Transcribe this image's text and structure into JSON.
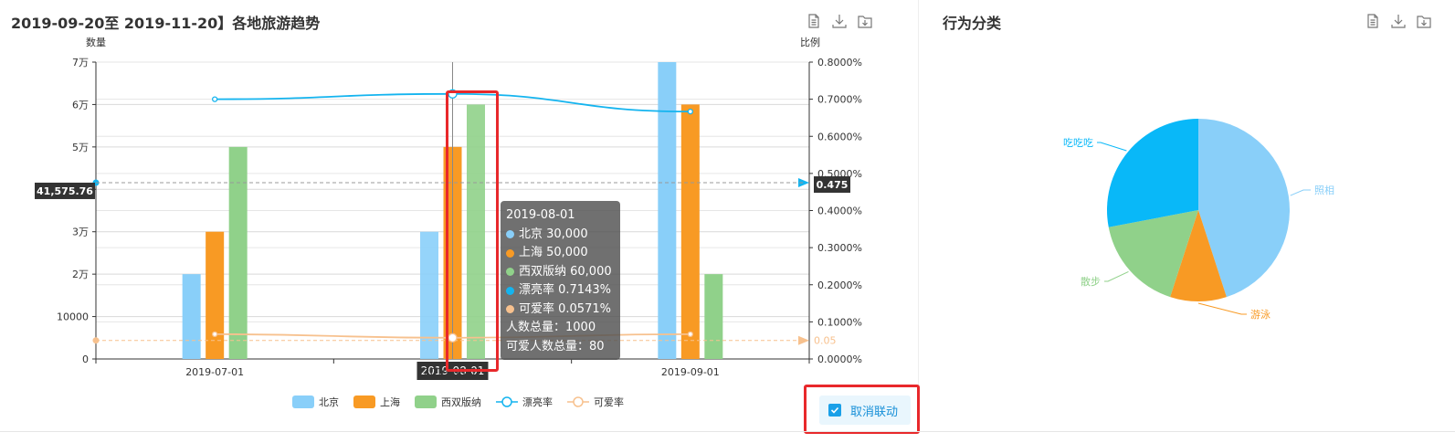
{
  "left_panel": {
    "title": "2019-09-20至 2019-11-20】各地旅游趋势",
    "toolbox": [
      "data-view-icon",
      "download-icon",
      "save-folder-icon"
    ]
  },
  "right_panel": {
    "title": "行为分类",
    "toolbox": [
      "data-view-icon",
      "download-icon",
      "save-folder-icon"
    ]
  },
  "unlink_button": {
    "label": "取消联动",
    "checked": true
  },
  "tooltip": {
    "title": "2019-08-01",
    "rows": [
      {
        "label": "北京  30,000",
        "color": "#89cff9"
      },
      {
        "label": "上海  50,000",
        "color": "#f89a24"
      },
      {
        "label": "西双版纳  60,000",
        "color": "#90d18a"
      },
      {
        "label": "漂亮率  0.7143%",
        "color": "#14b4ef"
      },
      {
        "label": "可爱率  0.0571%",
        "color": "#f7c18e"
      }
    ],
    "extra": [
      "人数总量：1000",
      "可爱人数总量：80"
    ]
  },
  "chart_data": [
    {
      "type": "bar",
      "title": "2019-09-20至 2019-11-20】各地旅游趋势",
      "categories": [
        "2019-07-01",
        "2019-08-01",
        "2019-09-01"
      ],
      "ylabel_left": "数量",
      "ylabel_right": "比例",
      "ylim_left": [
        0,
        70000
      ],
      "yticks_left": [
        "0",
        "10000",
        "2万",
        "3万",
        "",
        "5万",
        "6万",
        "7万"
      ],
      "ylim_right": [
        0,
        0.8
      ],
      "yticks_right": [
        "0.0000%",
        "0.1000%",
        "0.2000%",
        "0.3000%",
        "0.4000%",
        "0.5000%",
        "0.6000%",
        "0.7000%",
        "0.8000%"
      ],
      "series": [
        {
          "name": "北京",
          "type": "bar",
          "axis": "left",
          "color": "#89cff9",
          "values": [
            20000,
            30000,
            70000
          ]
        },
        {
          "name": "上海",
          "type": "bar",
          "axis": "left",
          "color": "#f89a24",
          "values": [
            30000,
            50000,
            60000
          ]
        },
        {
          "name": "西双版纳",
          "type": "bar",
          "axis": "left",
          "color": "#90d18a",
          "values": [
            50000,
            60000,
            20000
          ]
        },
        {
          "name": "漂亮率",
          "type": "line",
          "axis": "right",
          "color": "#14b4ef",
          "values": [
            0.7,
            0.7143,
            0.6667
          ]
        },
        {
          "name": "可爱率",
          "type": "line",
          "axis": "right",
          "color": "#f7c18e",
          "values": [
            0.0667,
            0.0571,
            0.0667
          ]
        }
      ],
      "mark_lines": [
        {
          "axis": "left",
          "value": 41575.76,
          "label": "41,575.76",
          "color": "#14b4ef"
        },
        {
          "axis": "right",
          "value": 0.475,
          "label": "0.475",
          "color": "#999999"
        },
        {
          "axis": "right",
          "value": 0.05,
          "label": "0.05",
          "color": "#f7c18e"
        }
      ],
      "axis_pointer_label": "2019-08-01",
      "legend_position": "bottom"
    },
    {
      "type": "pie",
      "title": "行为分类",
      "slices": [
        {
          "name": "照相",
          "value": 45,
          "color": "#89cff9"
        },
        {
          "name": "游泳",
          "value": 10,
          "color": "#f89a24"
        },
        {
          "name": "散步",
          "value": 17,
          "color": "#90d18a"
        },
        {
          "name": "吃吃吃",
          "value": 28,
          "color": "#09b8f8"
        }
      ]
    }
  ]
}
